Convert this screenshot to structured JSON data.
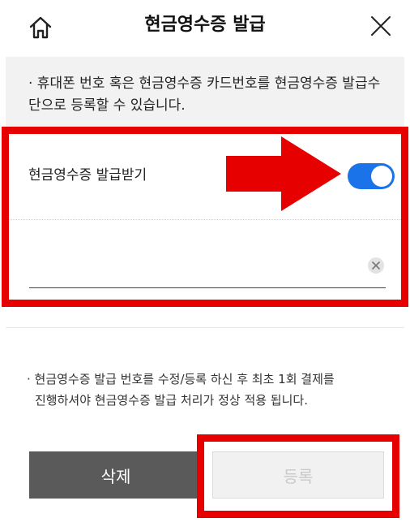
{
  "header": {
    "title": "현금영수증 발급",
    "home_icon": "home-icon",
    "close_icon": "close-icon"
  },
  "notice": {
    "text": "· 휴대폰 번호 혹은 현금영수증 카드번호를 현금영수증 발급수단으로 등록할 수 있습니다."
  },
  "toggle": {
    "label": "현금영수증 발급받기",
    "state": "on",
    "color": "#1a73e8"
  },
  "input": {
    "value": "",
    "placeholder": "",
    "clear_icon": "clear-icon"
  },
  "info": {
    "line1": "· 현금영수증 발급 번호를 수정/등록 하신 후 최초 1회 결제를",
    "line2": "진행하셔야 현금영수증 발급 처리가 정상 적용 됩니다."
  },
  "buttons": {
    "delete_label": "삭제",
    "register_label": "등록"
  },
  "annotations": {
    "highlight_color": "#e60000",
    "arrow_icon": "arrow-right-icon"
  }
}
